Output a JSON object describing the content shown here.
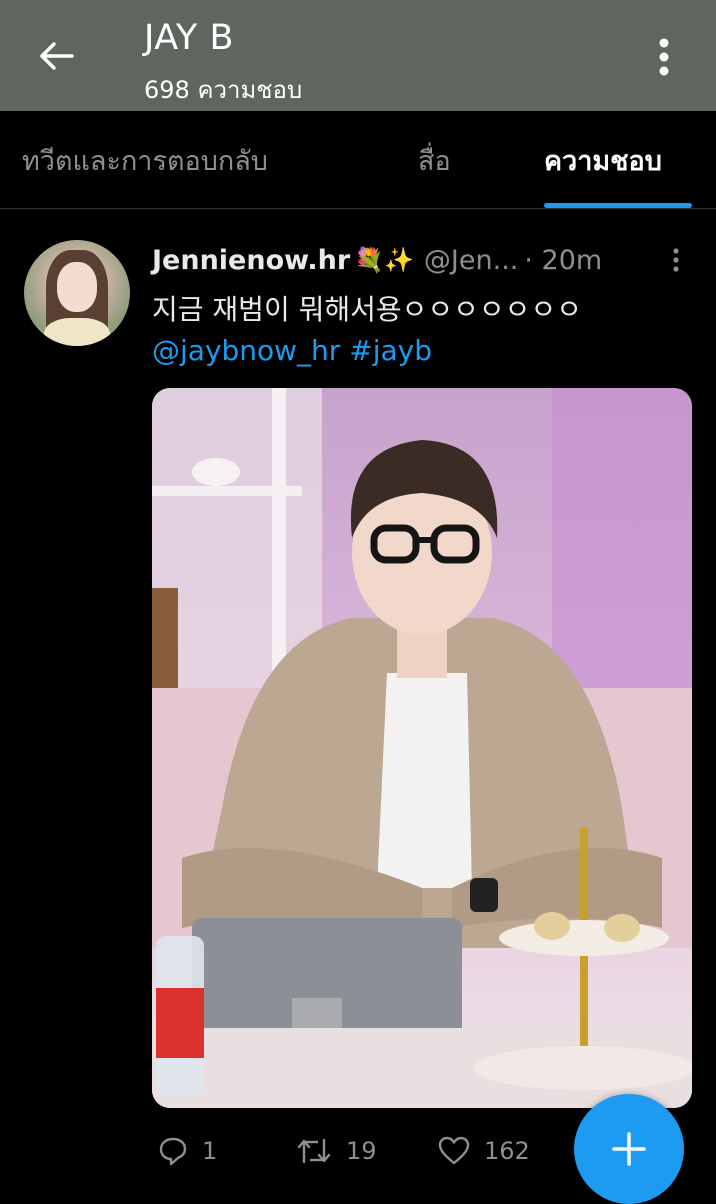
{
  "header": {
    "title": "JAY B",
    "subtitle": "698 ความชอบ"
  },
  "tabs": [
    {
      "label": "ทวีตและการตอบกลับ",
      "active": false
    },
    {
      "label": "สื่อ",
      "active": false
    },
    {
      "label": "ความชอบ",
      "active": true
    }
  ],
  "tweet": {
    "display_name": "Jennienow.hr",
    "name_emojis": "💐✨",
    "handle": "@Jen",
    "handle_ellipsis": "...",
    "time": "· 20m",
    "text": "지금 재범이 뭐해서용ㅇㅇㅇㅇㅇㅇㅇ",
    "mention": "@jaybnow_hr",
    "hashtag": "#jayb",
    "reply_count": "1",
    "retweet_count": "19",
    "like_count": "162"
  },
  "colors": {
    "header_bg": "#5f6660",
    "accent": "#1d9bf0",
    "muted_text": "#8b9094",
    "background": "#000000"
  },
  "icons": {
    "back": "arrow-left-icon",
    "more": "more-vertical-icon",
    "caret": "more-vertical-icon",
    "reply": "reply-icon",
    "retweet": "retweet-icon",
    "like": "heart-icon",
    "compose": "plus-icon"
  }
}
